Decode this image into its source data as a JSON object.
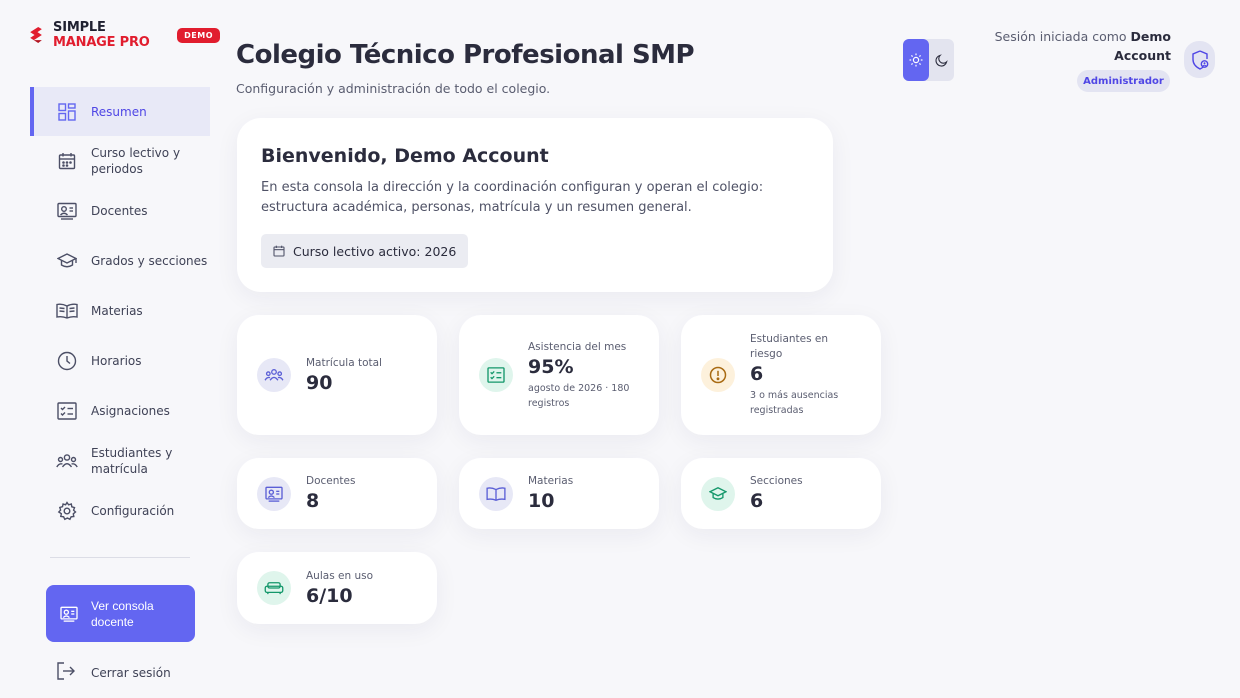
{
  "brand": {
    "name_part1": "SIMPLE ",
    "name_part2": "MANAGE PRO",
    "demo_badge": "DEMO"
  },
  "sidebar": {
    "items": [
      {
        "label": "Resumen",
        "icon": "grid-icon",
        "active": true
      },
      {
        "label": "Curso lectivo y periodos",
        "icon": "calendar-icon"
      },
      {
        "label": "Docentes",
        "icon": "id-card-icon"
      },
      {
        "label": "Grados y secciones",
        "icon": "graduation-cap-icon"
      },
      {
        "label": "Materias",
        "icon": "book-icon"
      },
      {
        "label": "Horarios",
        "icon": "clock-icon"
      },
      {
        "label": "Asignaciones",
        "icon": "checklist-icon"
      },
      {
        "label": "Estudiantes y matrícula",
        "icon": "users-icon"
      },
      {
        "label": "Configuración",
        "icon": "gear-icon"
      }
    ],
    "teacher_console_label": "Ver consola docente",
    "logout_label": "Cerrar sesión"
  },
  "header": {
    "title": "Colegio Técnico Profesional SMP",
    "subtitle": "Configuración y administración de todo el colegio.",
    "session_prefix": "Sesión iniciada como ",
    "session_user_line1": "Demo",
    "session_user_line2": "Account",
    "role": "Administrador"
  },
  "welcome": {
    "title": "Bienvenido, Demo Account",
    "text": "En esta consola la dirección y la coordinación configuran y operan el colegio: estructura académica, personas, matrícula y un resumen general.",
    "chip": "Curso lectivo activo: 2026"
  },
  "stats": [
    {
      "label": "Matrícula total",
      "value": "90",
      "icon": "users-icon",
      "color": "indigo"
    },
    {
      "label": "Asistencia del mes",
      "value": "95%",
      "note": "agosto de 2026 · 180 registros",
      "icon": "checklist-icon",
      "color": "green"
    },
    {
      "label": "Estudiantes en riesgo",
      "value": "6",
      "note": "3 o más ausencias registradas",
      "icon": "alert-icon",
      "color": "amber"
    },
    {
      "label": "Docentes",
      "value": "8",
      "icon": "id-card-icon",
      "color": "indigo"
    },
    {
      "label": "Materias",
      "value": "10",
      "icon": "book-icon",
      "color": "indigo"
    },
    {
      "label": "Secciones",
      "value": "6",
      "icon": "graduation-cap-icon",
      "color": "green"
    },
    {
      "label": "Aulas en uso",
      "value": "6/10",
      "icon": "sofa-icon",
      "color": "green"
    }
  ],
  "colors": {
    "accent": "#6366f1",
    "brand_red": "#e11d2e"
  }
}
